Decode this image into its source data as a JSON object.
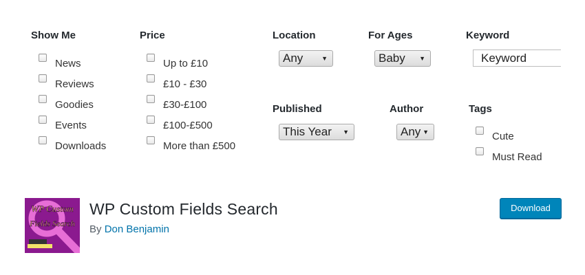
{
  "form": {
    "show_me": {
      "heading": "Show Me",
      "options": [
        "News",
        "Reviews",
        "Goodies",
        "Events",
        "Downloads"
      ]
    },
    "price": {
      "heading": "Price",
      "options": [
        "Up to £10",
        "£10 - £30",
        "£30-£100",
        "£100-£500",
        "More than £500"
      ]
    },
    "location": {
      "heading": "Location",
      "selected": "Any"
    },
    "for_ages": {
      "heading": "For Ages",
      "selected": "Baby"
    },
    "keyword": {
      "heading": "Keyword",
      "placeholder": "Keyword"
    },
    "published": {
      "heading": "Published",
      "selected": "This Year"
    },
    "author": {
      "heading": "Author",
      "selected": "Any"
    },
    "tags": {
      "heading": "Tags",
      "options": [
        "Cute",
        "Must Read"
      ]
    }
  },
  "plugin": {
    "icon_name": "wp-custom-fields-search-logo",
    "icon_text_line1": "WP Custom",
    "icon_text_line2": "Fields Search",
    "title": "WP Custom Fields Search",
    "by_prefix": "By",
    "author": "Don Benjamin",
    "download_label": "Download"
  },
  "colors": {
    "accent": "#0085ba",
    "link": "#0073aa",
    "icon_bg": "#8b1a8f"
  }
}
